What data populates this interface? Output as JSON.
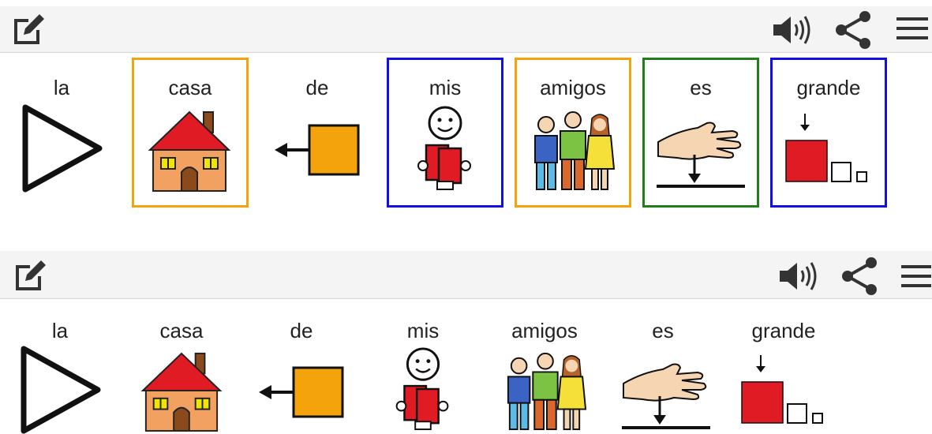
{
  "app": {
    "colors": {
      "orange": "#f5a30c",
      "blue": "#1010e6",
      "green": "#1f7f1f",
      "toolbar_bg": "#f4f4f4"
    },
    "toolbar": {
      "icons": [
        "edit-icon",
        "speaker-icon",
        "share-icon",
        "menu-icon"
      ]
    }
  },
  "sentence_top": {
    "play": "play-icon",
    "words": [
      {
        "label": "la",
        "symbol": "triangle-symbol",
        "border": ""
      },
      {
        "label": "casa",
        "symbol": "house-symbol",
        "border": "#f5a30c"
      },
      {
        "label": "de",
        "symbol": "arrow-square-symbol",
        "border": ""
      },
      {
        "label": "mis",
        "symbol": "person-symbol",
        "border": "#1010e6"
      },
      {
        "label": "amigos",
        "symbol": "friends-symbol",
        "border": "#f5a30c"
      },
      {
        "label": "es",
        "symbol": "hand-symbol",
        "border": "#1f7f1f"
      },
      {
        "label": "grande",
        "symbol": "big-square-symbol",
        "border": "#1010e6"
      }
    ]
  },
  "sentence_bottom": {
    "play": "play-icon",
    "words": [
      {
        "label": "la"
      },
      {
        "label": "casa"
      },
      {
        "label": "de"
      },
      {
        "label": "mis"
      },
      {
        "label": "amigos"
      },
      {
        "label": "es"
      },
      {
        "label": "grande"
      }
    ]
  }
}
